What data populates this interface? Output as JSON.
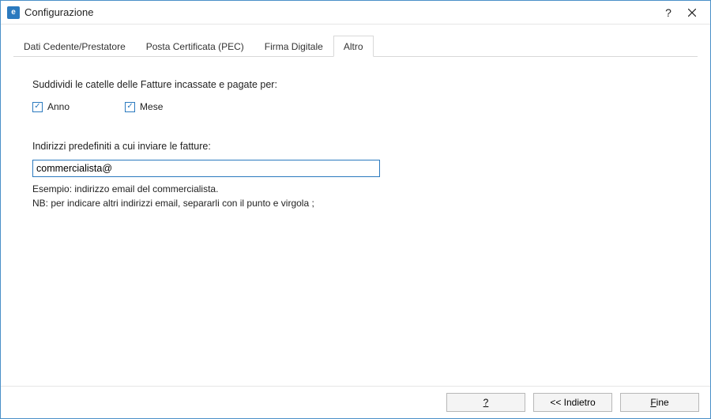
{
  "window": {
    "title": "Configurazione",
    "app_icon_letter": "e"
  },
  "tabs": {
    "items": [
      {
        "label": "Dati Cedente/Prestatore"
      },
      {
        "label": "Posta Certificata (PEC)"
      },
      {
        "label": "Firma Digitale"
      },
      {
        "label": "Altro"
      }
    ],
    "active_index": 3
  },
  "pane": {
    "split_label": "Suddividi le catelle delle Fatture incassate e pagate per:",
    "checkbox_anno": {
      "label": "Anno",
      "checked": true
    },
    "checkbox_mese": {
      "label": "Mese",
      "checked": true
    },
    "recipients_label": "Indirizzi predefiniti a cui inviare le fatture:",
    "recipients_value": "commercialista@",
    "example_text": "Esempio: indirizzo email del commercialista.",
    "nb_text": "NB: per indicare altri indirizzi email, separarli con il punto e virgola ;"
  },
  "footer": {
    "help_label": "?",
    "back_label": "<< Indietro",
    "finish_label": "Fine"
  }
}
